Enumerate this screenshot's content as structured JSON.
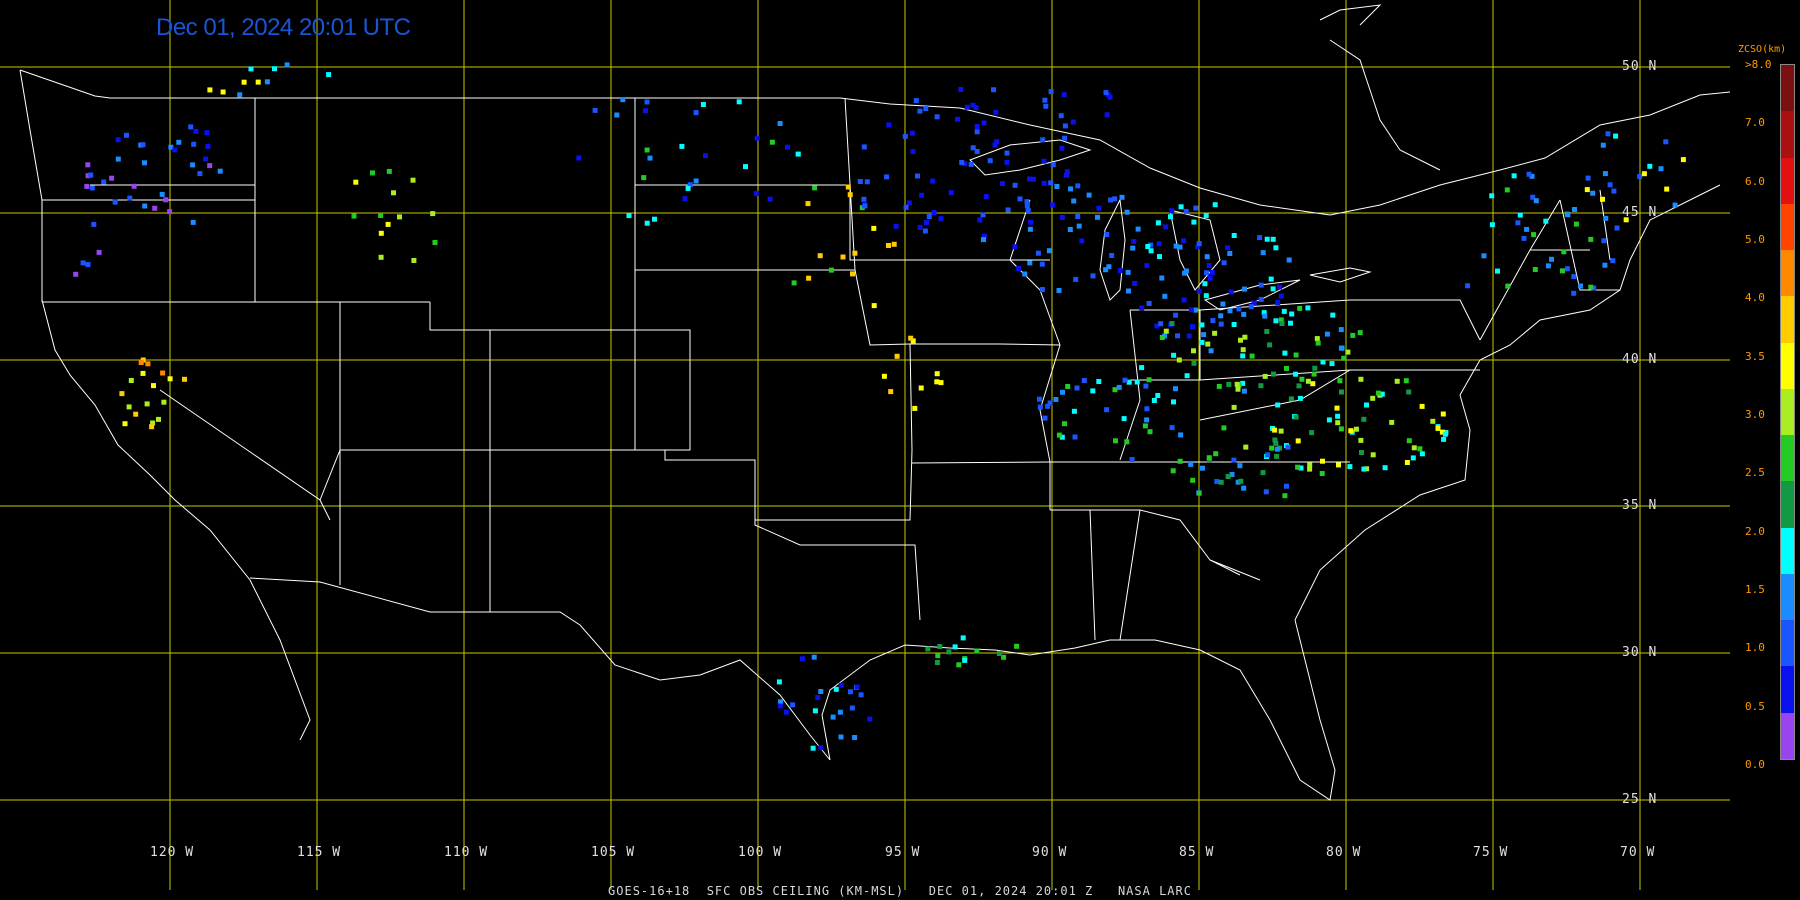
{
  "timestamp": "Dec 01, 2024 20:01 UTC",
  "footer": "GOES-16+18  SFC OBS CEILING (KM-MSL)   DEC 01, 2024 20:01 Z   NASA LARC",
  "grid": {
    "lat_labels": [
      "50 N",
      "45 N",
      "40 N",
      "35 N",
      "30 N",
      "25 N"
    ],
    "lon_labels": [
      "120 W",
      "115 W",
      "110 W",
      "105 W",
      "100 W",
      "95 W",
      "90 W",
      "85 W",
      "80 W",
      "75 W",
      "70 W"
    ]
  },
  "legend": {
    "title": "ZCSO(km)",
    "labels": [
      ">8.0",
      "7.0",
      "6.0",
      "5.0",
      "4.0",
      "3.5",
      "3.0",
      "2.5",
      "2.0",
      "1.5",
      "1.0",
      "0.5",
      "0.0"
    ],
    "colors": [
      "#7a1010",
      "#aa1010",
      "#e21010",
      "#ff4400",
      "#ff8800",
      "#ffcc00",
      "#ffff00",
      "#aaee22",
      "#22cc22",
      "#119944",
      "#00ffff",
      "#1a8cff",
      "#1a55ff",
      "#0a10ee",
      "#9944ee"
    ]
  },
  "colors": {
    "grid_line": "#c8c800",
    "boundary_line": "#ffffff",
    "background": "#000000"
  }
}
